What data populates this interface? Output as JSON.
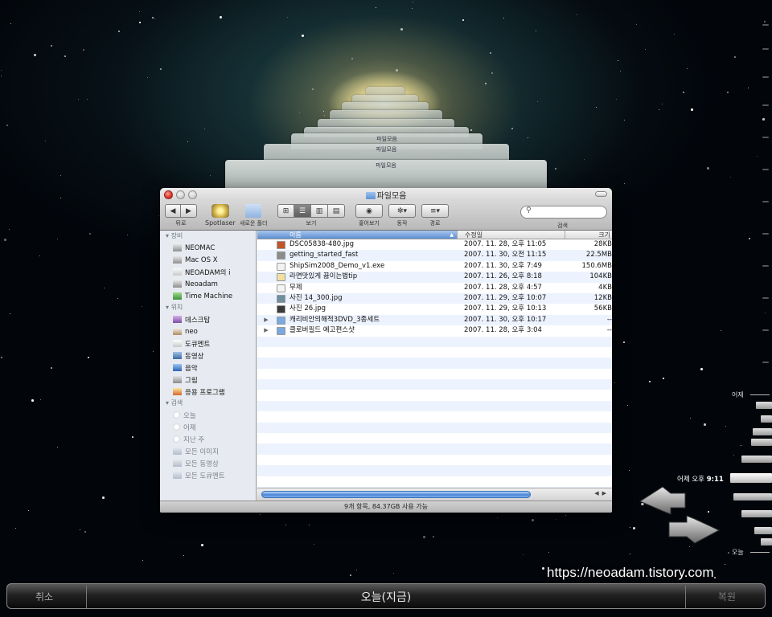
{
  "window": {
    "title": "파일모음",
    "stack_titles": [
      "파일모음",
      "파일모음"
    ]
  },
  "toolbar": {
    "back_label": "뒤로",
    "spotlaser_label": "Spotlaser",
    "new_folder_label": "새로운 폴더",
    "view_label": "보기",
    "quicklook_label": "훑어보기",
    "action_label": "동작",
    "path_label": "경로",
    "search_label": "검색",
    "search_placeholder": ""
  },
  "sidebar": {
    "devices_header": "장비",
    "devices": [
      {
        "label": "NEOMAC",
        "icon": "drive-icon"
      },
      {
        "label": "Mac OS X",
        "icon": "drive-icon"
      },
      {
        "label": "NEOADAM의 i",
        "icon": "ipod-icon"
      },
      {
        "label": "Neoadam",
        "icon": "drive-icon"
      },
      {
        "label": "Time Machine",
        "icon": "time-machine-icon"
      }
    ],
    "places_header": "위치",
    "places": [
      {
        "label": "데스크탑",
        "icon": "desktop-icon"
      },
      {
        "label": "neo",
        "icon": "home-icon"
      },
      {
        "label": "도큐멘트",
        "icon": "documents-icon"
      },
      {
        "label": "동영상",
        "icon": "movies-icon"
      },
      {
        "label": "음악",
        "icon": "music-icon"
      },
      {
        "label": "그림",
        "icon": "pictures-icon"
      },
      {
        "label": "응용 프로그램",
        "icon": "applications-icon"
      }
    ],
    "search_header": "검색",
    "searches": [
      {
        "label": "오늘",
        "icon": "clock-icon"
      },
      {
        "label": "어제",
        "icon": "clock-icon"
      },
      {
        "label": "지난 주",
        "icon": "clock-icon"
      },
      {
        "label": "모든 이미지",
        "icon": "smart-folder-icon"
      },
      {
        "label": "모든 동영상",
        "icon": "smart-folder-icon"
      },
      {
        "label": "모든 도큐멘트",
        "icon": "smart-folder-icon"
      }
    ]
  },
  "list": {
    "columns": {
      "name": "이름",
      "date": "수정일",
      "size": "크기"
    },
    "files": [
      {
        "name": "DSC05838-480.jpg",
        "date": "2007. 11. 28, 오후 11:05",
        "size": "28KB",
        "icon": "image-file-icon",
        "color": "#c2562b",
        "folder": false
      },
      {
        "name": "getting_started_fast",
        "date": "2007. 11. 30, 오전 11:15",
        "size": "22.5MB",
        "icon": "document-file-icon",
        "color": "#8c8c8c",
        "folder": false
      },
      {
        "name": "ShipSim2008_Demo_v1.exe",
        "date": "2007. 11. 30, 오후 7:49",
        "size": "150.6MB",
        "icon": "exe-file-icon",
        "color": "#f2f2f2",
        "folder": false
      },
      {
        "name": "라면맛있게 끓이는법tip",
        "date": "2007. 11. 26, 오후 8:18",
        "size": "104KB",
        "icon": "text-file-icon",
        "color": "#f2e0a0",
        "folder": false
      },
      {
        "name": "무제",
        "date": "2007. 11. 28, 오후 4:57",
        "size": "4KB",
        "icon": "blank-file-icon",
        "color": "#f4f4f4",
        "folder": false
      },
      {
        "name": "사진 14_300.jpg",
        "date": "2007. 11. 29, 오후 10:07",
        "size": "12KB",
        "icon": "image-file-icon",
        "color": "#6f8f9f",
        "folder": false
      },
      {
        "name": "사진 26.jpg",
        "date": "2007. 11. 29, 오후 10:13",
        "size": "56KB",
        "icon": "image-file-icon",
        "color": "#3a3a3a",
        "folder": false
      },
      {
        "name": "캐리비안의해적3DVD_3종세트",
        "date": "2007. 11. 30, 오후 10:17",
        "size": "--",
        "icon": "folder-icon",
        "color": "#7aa9e0",
        "folder": true
      },
      {
        "name": "클로버필드 예고편스샷",
        "date": "2007. 11. 28, 오후 3:04",
        "size": "--",
        "icon": "folder-icon",
        "color": "#7aa9e0",
        "folder": true
      }
    ]
  },
  "status": "9개 항목, 84.37GB 사용 가능",
  "timeline": {
    "top_label": "어제",
    "current_label": "어제 오후",
    "current_time": "9:11",
    "bottom_label": "오늘"
  },
  "bottom": {
    "cancel": "취소",
    "now": "오늘(지금)",
    "restore": "복원"
  },
  "watermark": "https://neoadam.tistory.com",
  "colors": {
    "accent_blue": "#5d8fd1",
    "close_red": "#d8342a"
  }
}
